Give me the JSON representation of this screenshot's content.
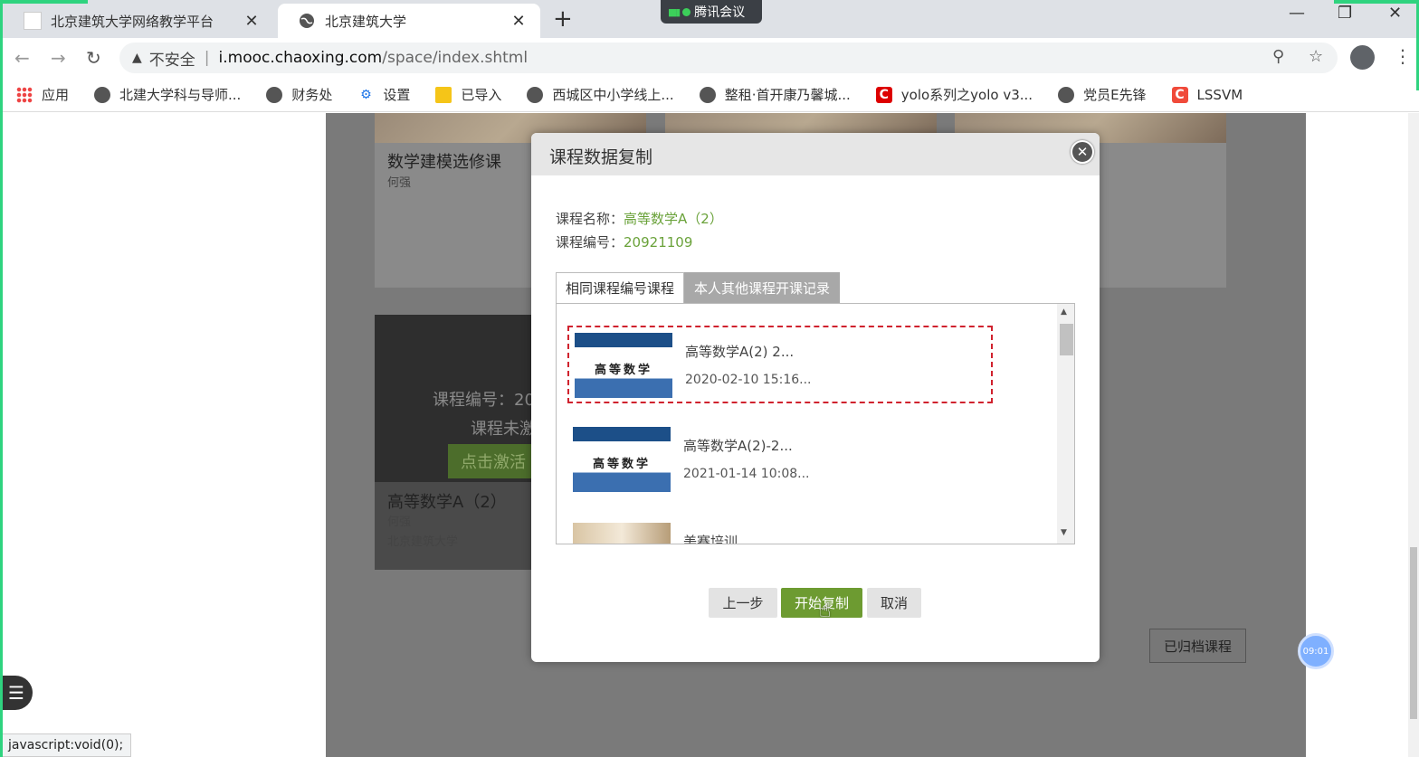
{
  "browser": {
    "tabs": [
      {
        "title": "北京建筑大学网络教学平台"
      },
      {
        "title": "北京建筑大学"
      }
    ],
    "new_tab": "+",
    "meeting_label": "腾讯会议",
    "window_controls": {
      "minimize": "—",
      "restore": "❐",
      "close": "✕"
    },
    "address": {
      "warning": "▲",
      "security_label": "不安全",
      "separator": "|",
      "host": "i.mooc.chaoxing.com",
      "path": "/space/index.shtml"
    },
    "bookmarks": [
      {
        "label": "应用",
        "icon": "apps-icon"
      },
      {
        "label": "北建大学科与导师...",
        "icon": "globe-icon"
      },
      {
        "label": "财务处",
        "icon": "globe-icon"
      },
      {
        "label": "设置",
        "icon": "gear-icon"
      },
      {
        "label": "已导入",
        "icon": "folder-icon"
      },
      {
        "label": "西城区中小学线上...",
        "icon": "globe-icon"
      },
      {
        "label": "整租·首开康乃馨城...",
        "icon": "globe-icon"
      },
      {
        "label": "yolo系列之yolo v3...",
        "icon": "csdn-icon"
      },
      {
        "label": "党员E先锋",
        "icon": "globe-icon"
      },
      {
        "label": "LSSVM",
        "icon": "csdn-icon"
      }
    ]
  },
  "background": {
    "card1": {
      "title": "数学建模选修课",
      "teacher": "何强"
    },
    "card2": {
      "code_label": "课程编号：20",
      "status": "课程未激",
      "activate": "点击激活",
      "title": "高等数学A（2）",
      "teacher": "何强",
      "school": "北京建筑大学"
    },
    "archived_button": "已归档课程",
    "timer": "09:01",
    "status_bar": "javascript:void(0);"
  },
  "modal": {
    "title": "课程数据复制",
    "course_name_label": "课程名称：",
    "course_name": "高等数学A（2）",
    "course_code_label": "课程编号：",
    "course_code": "20921109",
    "tabs": [
      "相同课程编号课程",
      "本人其他课程开课记录"
    ],
    "records": [
      {
        "name": "高等数学A(2) 2...",
        "date": "2020-02-10 15:16...",
        "thumb_text": "高等数学",
        "selected": true
      },
      {
        "name": "高等数学A(2)-2...",
        "date": "2021-01-14 10:08...",
        "thumb_text": "高等数学",
        "selected": false
      },
      {
        "name": "美赛培训",
        "date": "",
        "thumb_text": "",
        "selected": false
      }
    ],
    "buttons": {
      "prev": "上一步",
      "start": "开始复制",
      "cancel": "取消"
    },
    "close": "✕"
  },
  "colors": {
    "accent_green": "#6d9b31",
    "value_green": "#6aa23a",
    "selection_red": "#d0222e"
  }
}
